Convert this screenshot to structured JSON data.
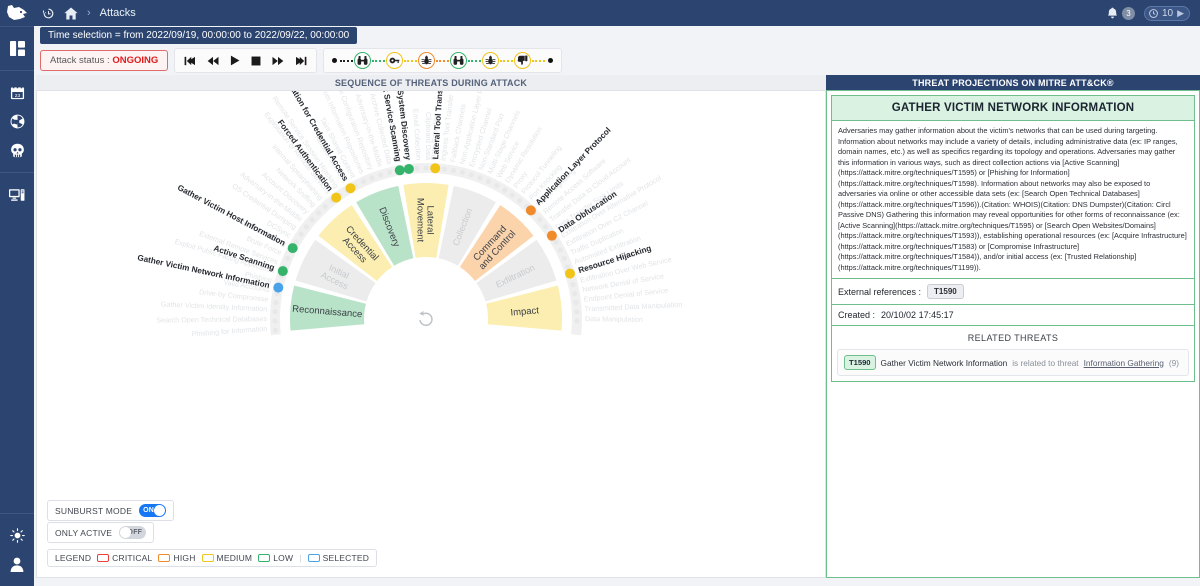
{
  "brand": {
    "logo_icon": "wolf-logo-icon"
  },
  "topbar": {
    "history_icon": "history-icon",
    "home_icon": "home-icon",
    "separator": "›",
    "current": "Attacks",
    "bell_icon": "bell-icon",
    "notification_count": "3",
    "refresh_clock_icon": "clock-icon",
    "refresh_interval": "10",
    "play_icon": "▶"
  },
  "rail": {
    "items": [
      {
        "name": "sidebar-item-dashboard",
        "icon": "dashboard-panels-icon"
      },
      {
        "name": "sidebar-item-calendar",
        "icon": "calendar-icon"
      },
      {
        "name": "sidebar-item-radiation",
        "icon": "radiation-icon"
      },
      {
        "name": "sidebar-item-threats",
        "icon": "skull-icon"
      },
      {
        "name": "sidebar-item-assets",
        "icon": "monitor-icon"
      }
    ],
    "bottom": [
      {
        "name": "sidebar-item-theme",
        "icon": "sun-icon"
      },
      {
        "name": "sidebar-item-account",
        "icon": "user-icon"
      }
    ]
  },
  "time_selection": {
    "text": "Time selection = from 2022/09/19, 00:00:00 to 2022/09/22, 00:00:00"
  },
  "attack_status": {
    "label": "Attack status :",
    "value": "ONGOING"
  },
  "transport": {
    "buttons": [
      {
        "name": "skip-to-start-button",
        "icon": "skip-start-icon"
      },
      {
        "name": "rewind-button",
        "icon": "rewind-icon"
      },
      {
        "name": "play-button",
        "icon": "play-icon"
      },
      {
        "name": "stop-button",
        "icon": "stop-icon"
      },
      {
        "name": "fast-forward-button",
        "icon": "fast-forward-icon"
      },
      {
        "name": "skip-to-end-button",
        "icon": "skip-end-icon"
      }
    ]
  },
  "sequence": {
    "start_dot": "start-dot",
    "end_dot": "end-dot",
    "nodes": [
      {
        "name": "sequence-node-reconnaissance-1",
        "icon": "binoculars-icon",
        "color": "#35b36b",
        "severity": "LOW"
      },
      {
        "name": "sequence-node-credential-access-1",
        "icon": "key-icon",
        "color": "#f0c419",
        "severity": "MEDIUM"
      },
      {
        "name": "sequence-node-lateral-movement-1",
        "icon": "bug-icon",
        "color": "#f08b2c",
        "severity": "HIGH"
      },
      {
        "name": "sequence-node-reconnaissance-2",
        "icon": "binoculars-icon",
        "color": "#35b36b",
        "severity": "LOW"
      },
      {
        "name": "sequence-node-discovery-1",
        "icon": "bug-icon",
        "color": "#f0c419",
        "severity": "MEDIUM"
      },
      {
        "name": "sequence-node-impact-1",
        "icon": "thumbs-down-icon",
        "color": "#f0c419",
        "severity": "MEDIUM"
      }
    ]
  },
  "panels": {
    "left_title": "SEQUENCE OF THREATS DURING ATTACK",
    "right_title": "THREAT PROJECTIONS ON MITRE ATT&CK®"
  },
  "sunburst": {
    "center_icon": "reset-rotate-icon",
    "tactics": [
      {
        "label": "Reconnaissance",
        "color": "#b9e3c8",
        "active": true
      },
      {
        "label": "Initial Access",
        "color": "#ececec",
        "active": false
      },
      {
        "label": "Credential Access",
        "color": "#fbeeb0",
        "active": true
      },
      {
        "label": "Discovery",
        "color": "#b9e3c8",
        "active": true
      },
      {
        "label": "Lateral Movement",
        "color": "#fbeeb0",
        "active": true
      },
      {
        "label": "Collection",
        "color": "#ececec",
        "active": false
      },
      {
        "label": "Command and Control",
        "color": "#fbd4ac",
        "active": true
      },
      {
        "label": "Exfiltration",
        "color": "#ececec",
        "active": false
      },
      {
        "label": "Impact",
        "color": "#fbeeb0",
        "active": true
      }
    ],
    "highlighted_techniques": [
      {
        "label": "Gather Victim Network Information",
        "dot": "#4aa3e8",
        "selected": true
      },
      {
        "label": "Active Scanning",
        "dot": "#35b36b",
        "selected": false
      },
      {
        "label": "Gather Victim Host Information",
        "dot": "#35b36b",
        "selected": false
      },
      {
        "label": "Forced Authentication",
        "dot": "#f0c419",
        "selected": false
      },
      {
        "label": "Exploitation for Credential Access",
        "dot": "#f0c419",
        "selected": false
      },
      {
        "label": "Network Service Scanning",
        "dot": "#35b36b",
        "selected": false
      },
      {
        "label": "Remote System Discovery",
        "dot": "#35b36b",
        "selected": false
      },
      {
        "label": "Lateral Tool Transfer",
        "dot": "#f0c419",
        "selected": false
      },
      {
        "label": "Application Layer Protocol",
        "dot": "#f08b2c",
        "selected": false
      },
      {
        "label": "Data Obfuscation",
        "dot": "#f08b2c",
        "selected": false
      },
      {
        "label": "Resource Hijacking",
        "dot": "#f0c419",
        "selected": false
      }
    ],
    "dim_techniques": [
      "Phishing for Information",
      "Search Open Technical Databases",
      "Gather Victim Identity Information",
      "Drive-by Compromise",
      "Valid Accounts",
      "Phishing",
      "Exploit Public-Facing Application",
      "External Remote Services",
      "Brute Force",
      "Network Sniffing",
      "DCSync",
      "OS Credential Dumping",
      "Adversary-in-the-Middle",
      "Account Discovery",
      "Network Sniffing",
      "Internal Spearphishing",
      "Exploitation of Remote Services",
      "Remote Service Session Hijacking",
      "Remote Services",
      "Taint Shared Content",
      "Data from Information Repositories",
      "Data from Configuration Repository",
      "Adversary-in-the-Middle",
      "Archive Collected Data",
      "Data Staged",
      "Screen Capture",
      "Email Collection",
      "Clipboard Data",
      "Data Encoding",
      "Ingress Tool Transfer",
      "Fallback Channels",
      "Non-Application Layer Protocol",
      "Encrypted Channel",
      "Non-Standard Port",
      "Multi-Stage Channels",
      "Web Service",
      "Dynamic Resolution",
      "Proxy",
      "Protocol Tunneling",
      "Port Knocking",
      "Traffic Signaling",
      "Remote Access Software",
      "Transfer Data to Cloud Account",
      "Data Transfer Size Limits",
      "Exfiltration Over Alternative Protocol",
      "Exfiltration Over C2 Channel",
      "Traffic Duplication",
      "Automated Exfiltration",
      "Scheduled Transfer",
      "Exfiltration Over Web Service",
      "Network Denial of Service",
      "Endpoint Denial of Service",
      "Transmitted Data Manipulation",
      "Data Manipulation"
    ]
  },
  "toggles": {
    "sunburst_mode": {
      "label": "SUNBURST MODE",
      "state": "ON"
    },
    "only_active": {
      "label": "ONLY ACTIVE",
      "state": "OFF"
    }
  },
  "legend": {
    "label": "LEGEND",
    "items": [
      {
        "label": "CRITICAL",
        "color": "#e8413f"
      },
      {
        "label": "HIGH",
        "color": "#f08b2c"
      },
      {
        "label": "MEDIUM",
        "color": "#f0c419"
      },
      {
        "label": "LOW",
        "color": "#35b36b"
      },
      {
        "label": "SELECTED",
        "color": "#4aa3e8"
      }
    ]
  },
  "technique_detail": {
    "title": "GATHER VICTIM NETWORK INFORMATION",
    "description": "Adversaries may gather information about the victim's networks that can be used during targeting. Information about networks may include a variety of details, including administrative data (ex: IP ranges, domain names, etc.) as well as specifics regarding its topology and operations. Adversaries may gather this information in various ways, such as direct collection actions via [Active Scanning] (https://attack.mitre.org/techniques/T1595) or [Phishing for Information] (https://attack.mitre.org/techniques/T1598). Information about networks may also be exposed to adversaries via online or other accessible data sets (ex: [Search Open Technical Databases] (https://attack.mitre.org/techniques/T1596)).(Citation: WHOIS)(Citation: DNS Dumpster)(Citation: Circl Passive DNS) Gathering this information may reveal opportunities for other forms of reconnaissance (ex: [Active Scanning](https://attack.mitre.org/techniques/T1595) or [Search Open Websites/Domains] (https://attack.mitre.org/techniques/T1593)), establishing operational resources (ex: [Acquire Infrastructure] (https://attack.mitre.org/techniques/T1583) or [Compromise Infrastructure] (https://attack.mitre.org/techniques/T1584)), and/or initial access (ex: [Trusted Relationship] (https://attack.mitre.org/techniques/T1199)).",
    "external_refs_label": "External references :",
    "external_ref_tag": "T1590",
    "created_label": "Created :",
    "created_value": "20/10/02 17:45:17"
  },
  "related_threats": {
    "title": "RELATED THREATS",
    "items": [
      {
        "tag": "T1590",
        "technique": "Gather Victim Network Information",
        "relation": "is related to threat",
        "threat": "Information Gathering",
        "count": "(9)"
      }
    ]
  }
}
